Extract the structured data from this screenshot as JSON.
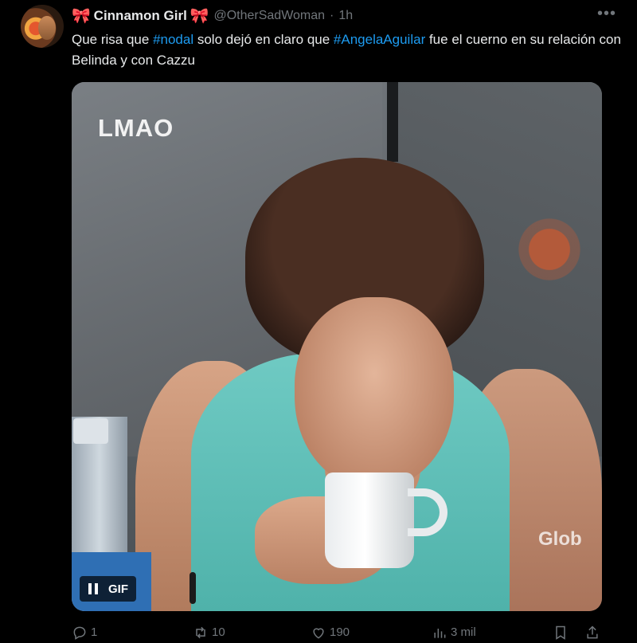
{
  "tweet": {
    "author_name": "Cinnamon Girl",
    "author_emoji": "🎀",
    "handle": "@OtherSadWoman",
    "separator": "·",
    "time": "1h",
    "more_label": "•••",
    "text_parts": {
      "p1": "Que risa que ",
      "hashtag1": "#nodal",
      "p2": " solo dejó en claro que ",
      "hashtag2": "#AngelaAguilar",
      "p3": " fue el cuerno en su relación con Belinda y con Cazzu"
    }
  },
  "media": {
    "overlay_text": "LMAO",
    "watermark": "Glob",
    "gif_label": "GIF"
  },
  "actions": {
    "replies": "1",
    "retweets": "10",
    "likes": "190",
    "views": "3 mil"
  },
  "colors": {
    "background": "#000000",
    "text": "#e7e9ea",
    "muted": "#71767b",
    "link": "#1d9bf0",
    "bow": "#e0245e"
  }
}
